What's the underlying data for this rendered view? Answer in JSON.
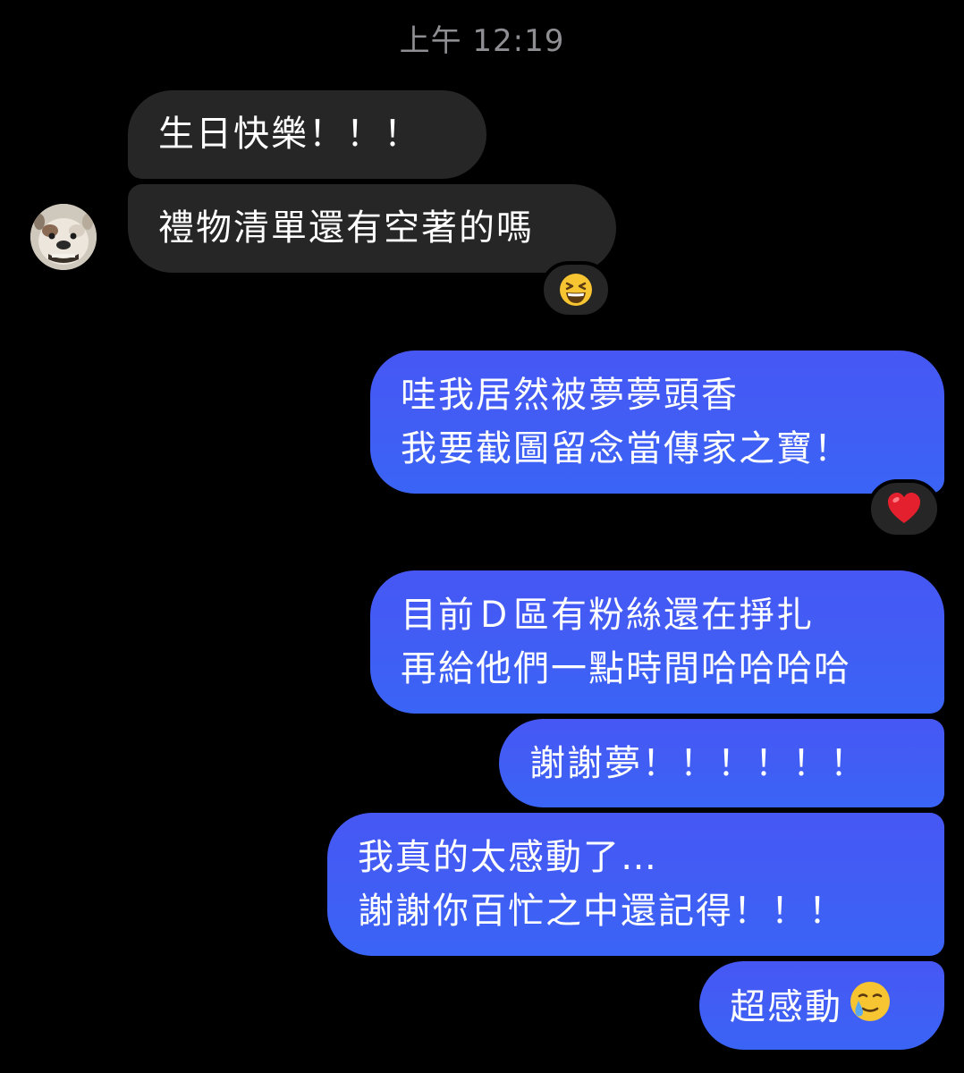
{
  "timestamp": "上午 12:19",
  "messages": [
    {
      "id": "m1",
      "direction": "incoming",
      "lines": [
        "生日快樂！！！"
      ]
    },
    {
      "id": "m2",
      "direction": "incoming",
      "lines": [
        "禮物清單還有空著的嗎"
      ],
      "reaction": "grinning-squinting-face"
    },
    {
      "id": "m3",
      "direction": "outgoing",
      "lines": [
        "哇我居然被夢夢頭香",
        "我要截圖留念當傳家之寶！"
      ],
      "reaction": "red-heart"
    },
    {
      "id": "m4",
      "direction": "outgoing",
      "lines": [
        "目前Ｄ區有粉絲還在掙扎",
        "再給他們一點時間哈哈哈哈"
      ]
    },
    {
      "id": "m5",
      "direction": "outgoing",
      "lines": [
        "謝謝夢！！！！！！"
      ]
    },
    {
      "id": "m6",
      "direction": "outgoing",
      "lines": [
        "我真的太感動了…",
        "謝謝你百忙之中還記得！！！"
      ]
    },
    {
      "id": "m7",
      "direction": "outgoing",
      "lines": [
        "超感動"
      ],
      "trailing_emoji": "crying-smile-face"
    }
  ],
  "colors": {
    "background": "#000000",
    "incoming_bubble": "#262626",
    "outgoing_bubble": "#3d5cf5",
    "timestamp_text": "#8e8e93"
  },
  "avatar": {
    "icon": "bulldog-avatar"
  }
}
